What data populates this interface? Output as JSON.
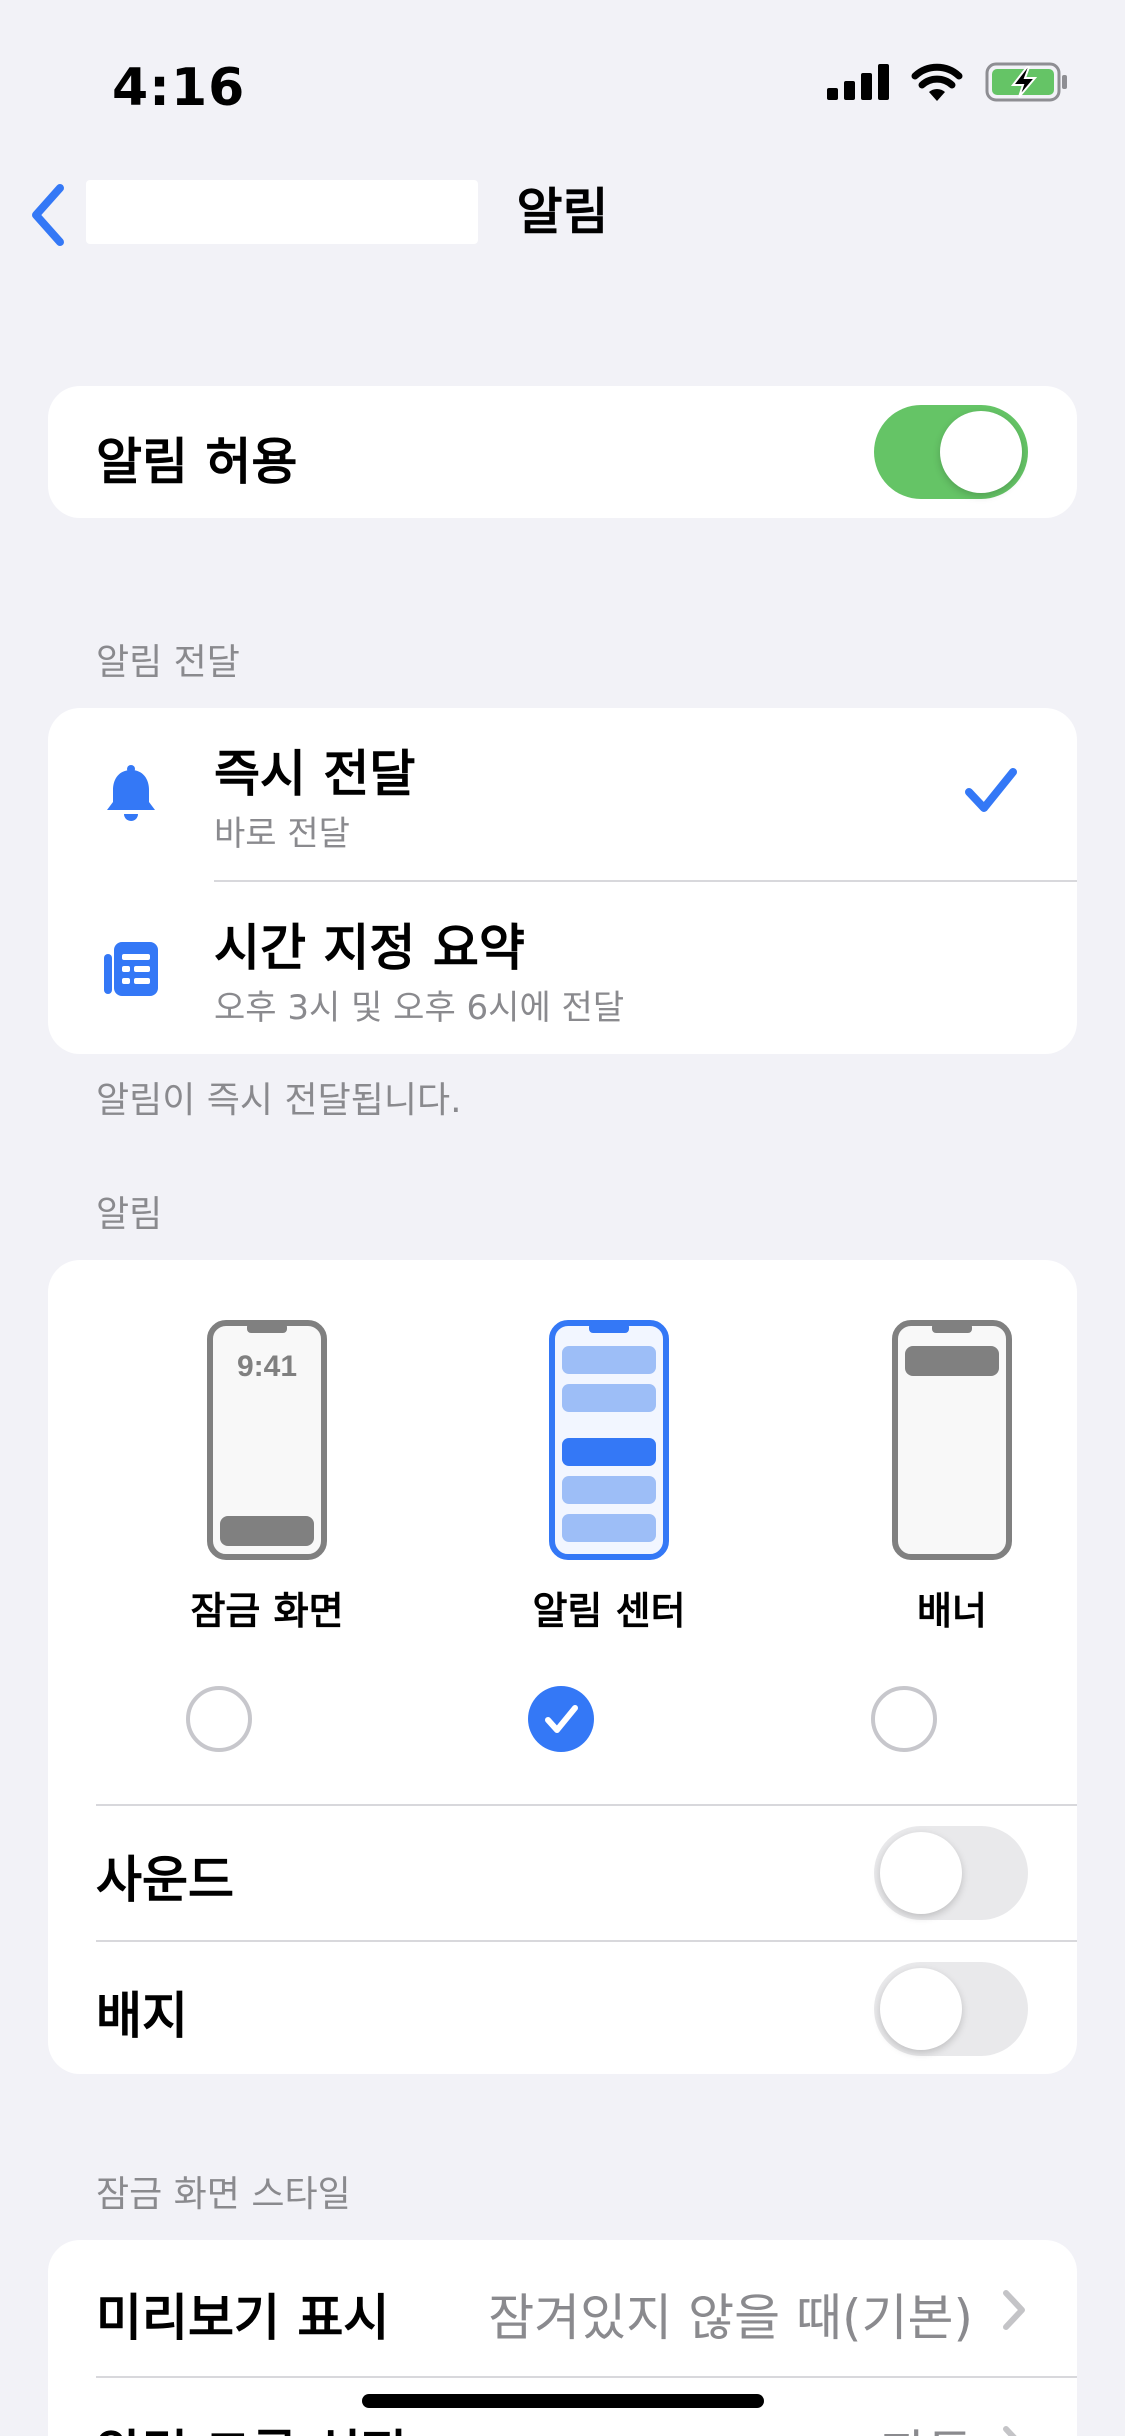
{
  "status_bar": {
    "time": "4:16"
  },
  "nav": {
    "title": "알림",
    "back_label": ""
  },
  "allow_notifications": {
    "label": "알림 허용",
    "enabled": true
  },
  "delivery": {
    "header": "알림 전달",
    "options": [
      {
        "title": "즉시 전달",
        "subtitle": "바로 전달",
        "icon": "bell-icon",
        "selected": true
      },
      {
        "title": "시간 지정 요약",
        "subtitle": "오후 3시 및 오후 6시에 전달",
        "icon": "scheduled-summary-icon",
        "selected": false
      }
    ],
    "footer": "알림이 즉시 전달됩니다."
  },
  "alerts": {
    "header": "알림",
    "styles": [
      {
        "label": "잠금 화면",
        "preview_time": "9:41",
        "selected": false
      },
      {
        "label": "알림 센터",
        "selected": true
      },
      {
        "label": "배너",
        "selected": false
      }
    ],
    "sounds": {
      "label": "사운드",
      "enabled": false
    },
    "badges": {
      "label": "배지",
      "enabled": false
    }
  },
  "lock_screen_appearance": {
    "header": "잠금 화면 스타일",
    "show_previews": {
      "label": "미리보기 표시",
      "value": "잠겨있지 않을 때(기본)"
    },
    "notification_grouping": {
      "label": "알림 그룹 설정",
      "value": "자동"
    }
  },
  "colors": {
    "accent": "#3478f6",
    "toggle_on": "#65c466",
    "secondary_text": "#8a8a8e",
    "background": "#f2f2f7"
  }
}
